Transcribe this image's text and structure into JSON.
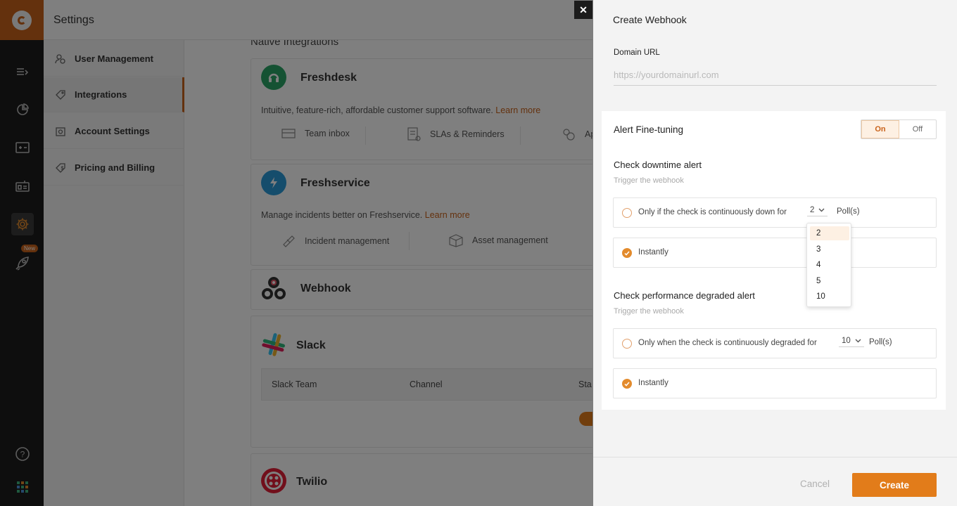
{
  "sidebar_rail": {
    "new_badge": "New",
    "icons": [
      "logo-icon",
      "list-icon",
      "reports-icon",
      "dashboard-icon",
      "status-page-icon",
      "gear-icon",
      "rocket-icon",
      "help-icon",
      "apps-grid-icon"
    ]
  },
  "settings": {
    "title": "Settings",
    "items": [
      {
        "label": "User Management",
        "icon": "users-icon"
      },
      {
        "label": "Integrations",
        "icon": "tag-icon"
      },
      {
        "label": "Account Settings",
        "icon": "settings-icon"
      },
      {
        "label": "Pricing and Billing",
        "icon": "billing-icon"
      }
    ]
  },
  "main": {
    "section_label": "Native Integrations",
    "freshdesk": {
      "title": "Freshdesk",
      "desc": "Intuitive, feature-rich, affordable customer support software.",
      "learn_more": "Learn more",
      "features": [
        "Team inbox",
        "SLAs & Reminders",
        "Ap"
      ]
    },
    "freshservice": {
      "title": "Freshservice",
      "desc": "Manage incidents better on Freshservice.",
      "learn_more": "Learn more",
      "features": [
        "Incident management",
        "Asset management"
      ]
    },
    "webhook": {
      "title": "Webhook"
    },
    "slack": {
      "title": "Slack",
      "columns": [
        "Slack Team",
        "Channel",
        "Sta"
      ]
    },
    "twilio": {
      "title": "Twilio"
    }
  },
  "drawer": {
    "close": "✕",
    "title": "Create Webhook",
    "domain_label": "Domain URL",
    "domain_placeholder": "https://yourdomainurl.com",
    "fine_tuning": {
      "title": "Alert Fine-tuning",
      "on": "On",
      "off": "Off",
      "downtime": {
        "title": "Check downtime alert",
        "sub": "Trigger the webhook",
        "option1": "Only if the check is continuously down for",
        "option1_value": "2",
        "polls": "Poll(s)",
        "option2": "Instantly"
      },
      "performance": {
        "title": "Check performance degraded alert",
        "sub": "Trigger the webhook",
        "option1": "Only when the check is continuously degraded for",
        "option1_value": "10",
        "polls": "Poll(s)",
        "option2": "Instantly"
      }
    },
    "dropdown_options": [
      "2",
      "3",
      "4",
      "5",
      "10"
    ],
    "cancel": "Cancel",
    "create": "Create"
  },
  "colors": {
    "accent": "#e27c1a",
    "rail": "#1c1c1c"
  }
}
